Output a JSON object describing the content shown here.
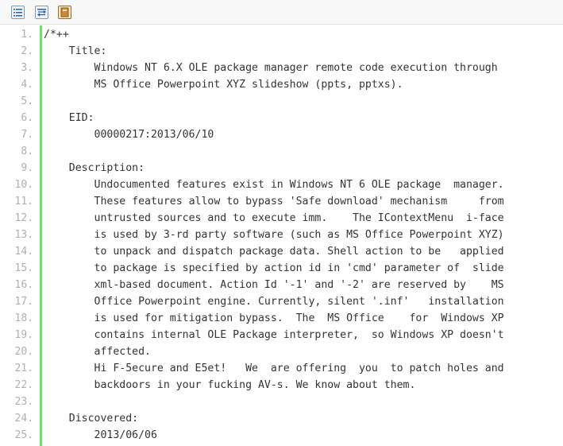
{
  "toolbar": {
    "buttons": [
      {
        "name": "view-source-icon"
      },
      {
        "name": "copy-to-clipboard-icon"
      },
      {
        "name": "print-icon"
      }
    ]
  },
  "code": {
    "lines": [
      {
        "number": "1.",
        "text": "/*++"
      },
      {
        "number": "2.",
        "text": "    Title:"
      },
      {
        "number": "3.",
        "text": "        Windows NT 6.X OLE package manager remote code execution through"
      },
      {
        "number": "4.",
        "text": "        MS Office Powerpoint XYZ slideshow (ppts, pptxs)."
      },
      {
        "number": "5.",
        "text": ""
      },
      {
        "number": "6.",
        "text": "    EID:"
      },
      {
        "number": "7.",
        "text": "        00000217:2013/06/10"
      },
      {
        "number": "8.",
        "text": ""
      },
      {
        "number": "9.",
        "text": "    Description:"
      },
      {
        "number": "10.",
        "text": "        Undocumented features exist in Windows NT 6 OLE package  manager."
      },
      {
        "number": "11.",
        "text": "        These features allow to bypass 'Safe download' mechanism     from"
      },
      {
        "number": "12.",
        "text": "        untrusted sources and to execute imm.    The IContextMenu  i-face"
      },
      {
        "number": "13.",
        "text": "        is used by 3-rd party software (such as MS Office Powerpoint XYZ)"
      },
      {
        "number": "14.",
        "text": "        to unpack and dispatch package data. Shell action to be   applied"
      },
      {
        "number": "15.",
        "text": "        to package is specified by action id in 'cmd' parameter of  slide"
      },
      {
        "number": "16.",
        "text": "        xml-based document. Action Id '-1' and '-2' are reserved by    MS"
      },
      {
        "number": "17.",
        "text": "        Office Powerpoint engine. Currently, silent '.inf'   installation"
      },
      {
        "number": "18.",
        "text": "        is used for mitigation bypass.  The  MS Office    for  Windows XP"
      },
      {
        "number": "19.",
        "text": "        contains internal OLE Package interpreter,  so Windows XP doesn't"
      },
      {
        "number": "20.",
        "text": "        affected."
      },
      {
        "number": "21.",
        "text": "        Hi F-5ecure and E5et!   We  are offering  you  to patch holes and"
      },
      {
        "number": "22.",
        "text": "        backdoors in your fucking AV-s. We know about them."
      },
      {
        "number": "23.",
        "text": ""
      },
      {
        "number": "24.",
        "text": "    Discovered:"
      },
      {
        "number": "25.",
        "text": "        2013/06/06"
      }
    ]
  },
  "colors": {
    "gutter_border": "#6ce26c",
    "line_number": "#afafaf",
    "code_text": "#333333",
    "toolbar_bg": "#f8f8f8"
  }
}
